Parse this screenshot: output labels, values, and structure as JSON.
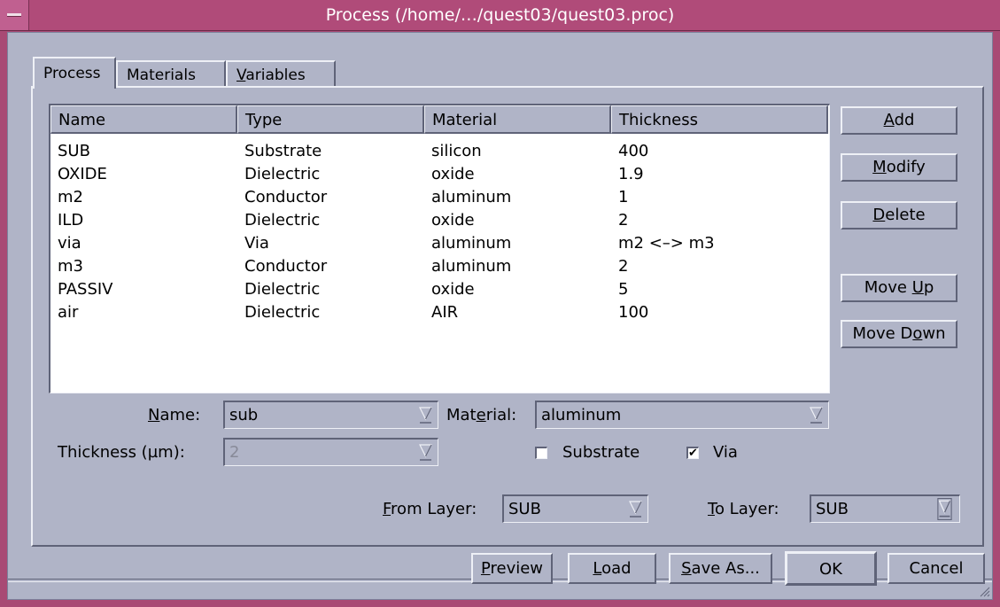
{
  "window": {
    "title": "Process (/home/…/quest03/quest03.proc)"
  },
  "tabs": [
    {
      "pre": "Process",
      "u": "",
      "post": ""
    },
    {
      "pre": "Materials",
      "u": "",
      "post": ""
    },
    {
      "pre": "",
      "u": "V",
      "post": "ariables"
    }
  ],
  "table": {
    "columns": [
      "Name",
      "Type",
      "Material",
      "Thickness"
    ],
    "rows": [
      [
        "SUB",
        "Substrate",
        "silicon",
        "400"
      ],
      [
        "OXIDE",
        "Dielectric",
        "oxide",
        "1.9"
      ],
      [
        "m2",
        "Conductor",
        "aluminum",
        "1"
      ],
      [
        "ILD",
        "Dielectric",
        "oxide",
        "2"
      ],
      [
        "via",
        "Via",
        "aluminum",
        "m2 <–> m3"
      ],
      [
        "m3",
        "Conductor",
        "aluminum",
        "2"
      ],
      [
        "PASSIV",
        "Dielectric",
        "oxide",
        "5"
      ],
      [
        "air",
        "Dielectric",
        "AIR",
        "100"
      ]
    ]
  },
  "side_buttons": {
    "add": {
      "pre": "",
      "u": "A",
      "post": "dd"
    },
    "modify": {
      "pre": "",
      "u": "M",
      "post": "odify"
    },
    "delete": {
      "pre": "",
      "u": "D",
      "post": "elete"
    },
    "move_up": {
      "pre": "Move ",
      "u": "U",
      "post": "p"
    },
    "move_down": {
      "pre": "Move D",
      "u": "o",
      "post": "wn"
    }
  },
  "form": {
    "name_label": {
      "pre": "",
      "u": "N",
      "post": "ame:"
    },
    "name_value": "sub",
    "material_label": {
      "pre": "Mat",
      "u": "e",
      "post": "rial:"
    },
    "material_value": "aluminum",
    "thickness_label": "Thickness (µm):",
    "thickness_value": "2",
    "substrate_label": "Substrate",
    "substrate_checked": false,
    "via_label": "Via",
    "via_checked": true,
    "from_layer_label": {
      "pre": "",
      "u": "F",
      "post": "rom Layer:"
    },
    "from_layer_value": "SUB",
    "to_layer_label": {
      "pre": "",
      "u": "T",
      "post": "o Layer:"
    },
    "to_layer_value": "SUB"
  },
  "bottom_buttons": {
    "preview": {
      "pre": "",
      "u": "P",
      "post": "review"
    },
    "load": {
      "pre": "",
      "u": "L",
      "post": "oad"
    },
    "save_as": {
      "pre": "",
      "u": "S",
      "post": "ave As..."
    },
    "ok": "OK",
    "cancel": "Cancel"
  },
  "colors": {
    "titlebar": "#b04b79",
    "dialog_bg": "#b0b4c7",
    "list_bg": "#ffffff"
  }
}
